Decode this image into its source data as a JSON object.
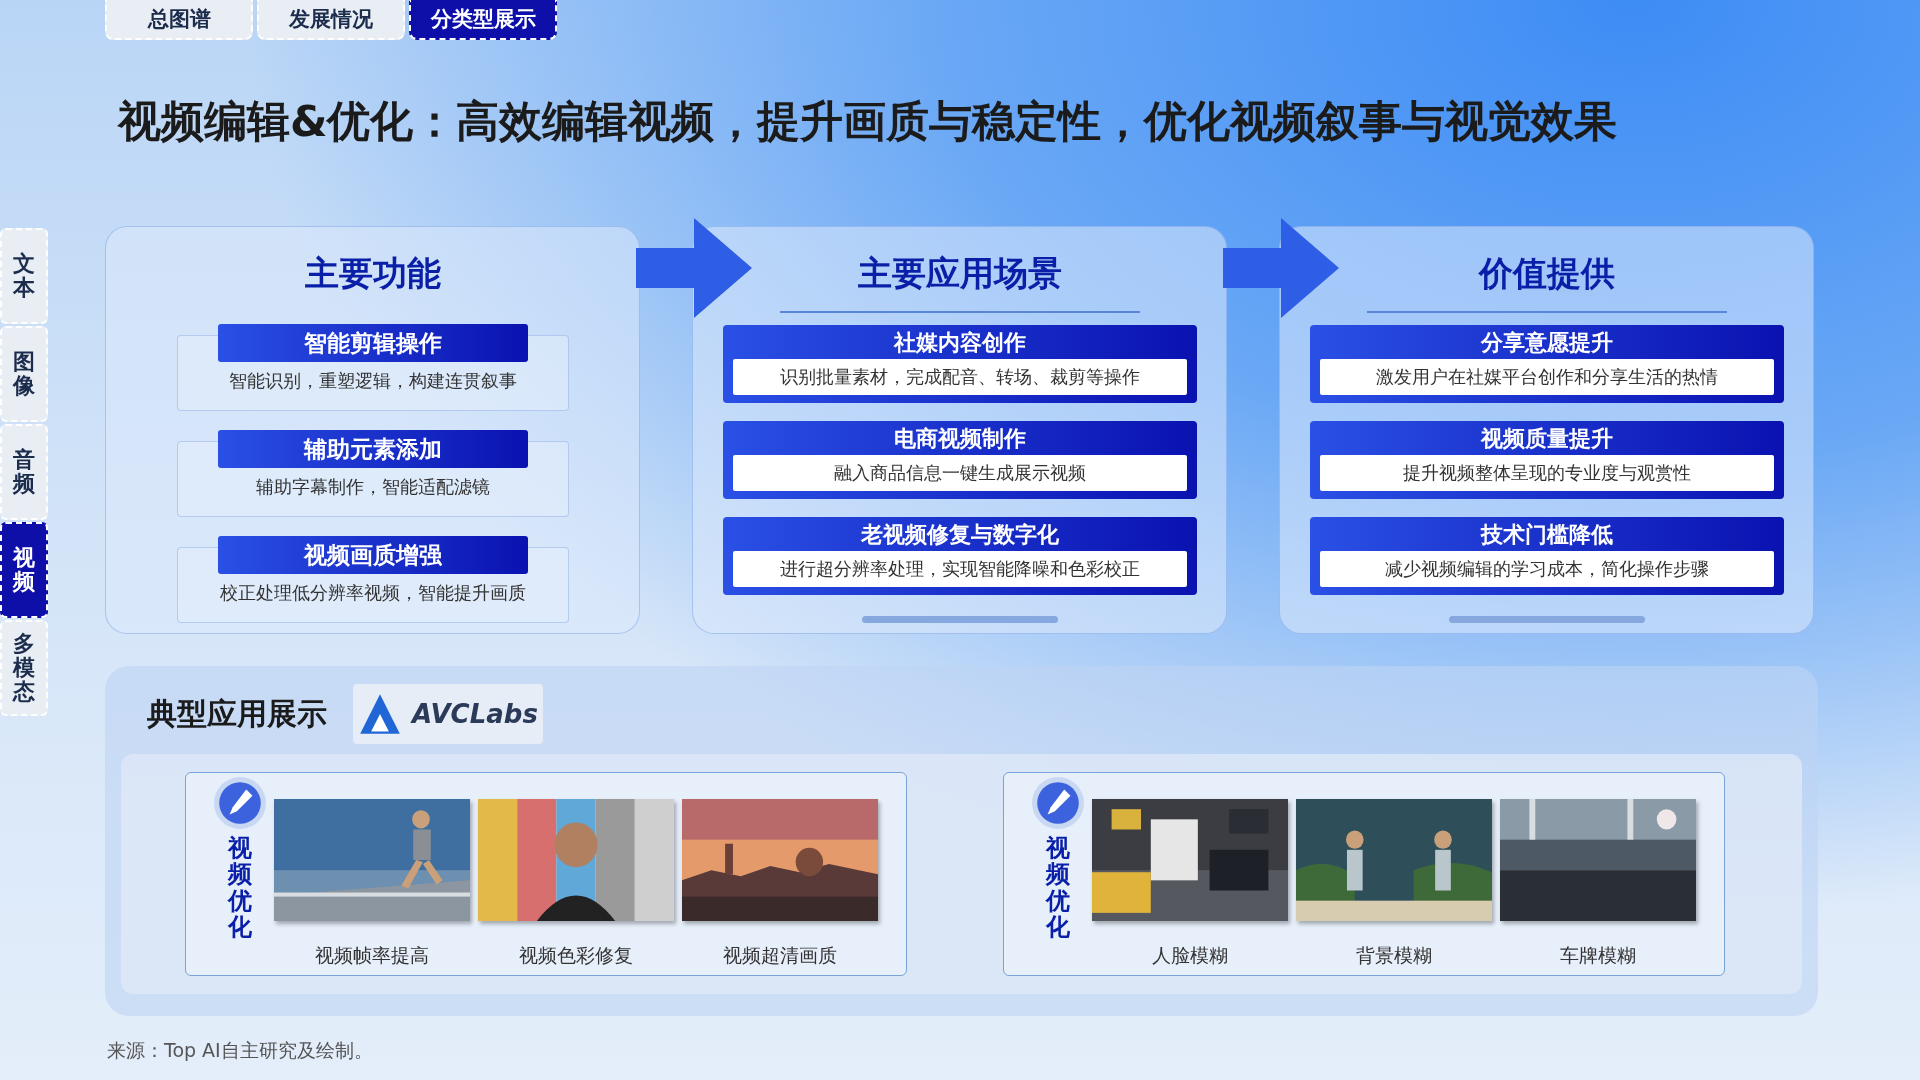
{
  "tabs": [
    {
      "label": "总图谱",
      "selected": false
    },
    {
      "label": "发展情况",
      "selected": false
    },
    {
      "label": "分类型展示",
      "selected": true
    }
  ],
  "title": "视频编辑&优化：高效编辑视频，提升画质与稳定性，优化视频叙事与视觉效果",
  "sidebar": [
    {
      "label": "文本",
      "selected": false
    },
    {
      "label": "图像",
      "selected": false
    },
    {
      "label": "音频",
      "selected": false
    },
    {
      "label": "视频",
      "selected": true
    },
    {
      "label": "多模态",
      "selected": false
    }
  ],
  "panels": [
    {
      "kind": "tagged",
      "title": "主要功能",
      "items": [
        {
          "title": "智能剪辑操作",
          "text": "智能识别，重塑逻辑，构建连贯叙事"
        },
        {
          "title": "辅助元素添加",
          "text": "辅助字幕制作，智能适配滤镜"
        },
        {
          "title": "视频画质增强",
          "text": "校正处理低分辨率视频，智能提升画质"
        }
      ]
    },
    {
      "kind": "boxed",
      "title": "主要应用场景",
      "items": [
        {
          "title": "社媒内容创作",
          "text": "识别批量素材，完成配音、转场、裁剪等操作"
        },
        {
          "title": "电商视频制作",
          "text": "融入商品信息一键生成展示视频"
        },
        {
          "title": "老视频修复与数字化",
          "text": "进行超分辨率处理，实现智能降噪和色彩校正"
        }
      ]
    },
    {
      "kind": "boxed",
      "title": "价值提供",
      "items": [
        {
          "title": "分享意愿提升",
          "text": "激发用户在社媒平台创作和分享生活的热情"
        },
        {
          "title": "视频质量提升",
          "text": "提升视频整体呈现的专业度与观赏性"
        },
        {
          "title": "技术门槛降低",
          "text": "减少视频编辑的学习成本，简化操作步骤"
        }
      ]
    }
  ],
  "showcase": {
    "title": "典型应用展示",
    "logo": "AVCLabs",
    "groups": [
      {
        "label": "视频优化",
        "items": [
          {
            "label": "视频帧率提高"
          },
          {
            "label": "视频色彩修复"
          },
          {
            "label": "视频超清画质"
          }
        ]
      },
      {
        "label": "视频优化",
        "items": [
          {
            "label": "人脸模糊"
          },
          {
            "label": "背景模糊"
          },
          {
            "label": "车牌模糊"
          }
        ]
      }
    ]
  },
  "source": "来源：Top AI自主研究及绘制。"
}
